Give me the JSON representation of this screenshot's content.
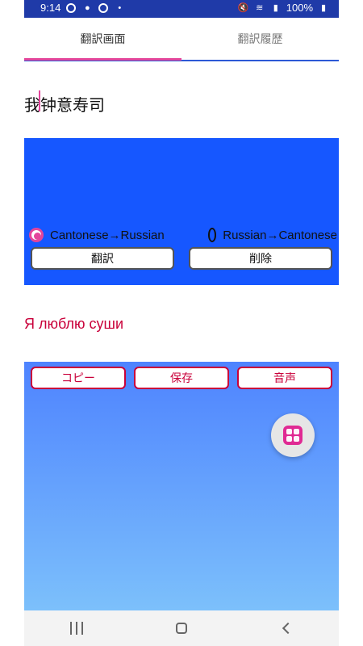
{
  "status": {
    "time": "9:14",
    "battery": "100%"
  },
  "tabs": [
    {
      "label": "翻訳画面",
      "active": true
    },
    {
      "label": "翻訳履歴",
      "active": false
    }
  ],
  "input": {
    "text": "我钟意寿司"
  },
  "panel1": {
    "radio": [
      {
        "label": "Cantonese→Russian",
        "checked": true
      },
      {
        "label": "Russian→Cantonese",
        "checked": false
      }
    ],
    "buttons": [
      {
        "label": "翻訳"
      },
      {
        "label": "削除"
      }
    ]
  },
  "output": {
    "text": "Я люблю суши"
  },
  "panel2": {
    "buttons": [
      {
        "label": "コピー"
      },
      {
        "label": "保存"
      },
      {
        "label": "音声"
      }
    ]
  }
}
